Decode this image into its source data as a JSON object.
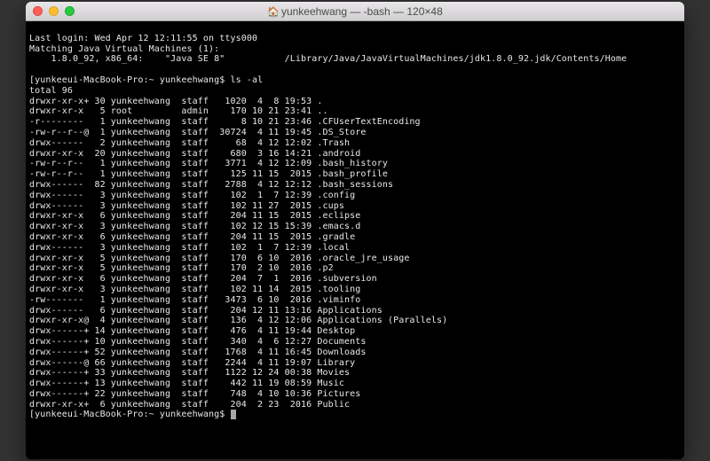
{
  "window": {
    "title_user": "yunkeehwang",
    "title_shell": "-bash",
    "title_size": "120×48"
  },
  "last_login": "Last login: Wed Apr 12 12:11:55 on ttys000",
  "java_match_header": "Matching Java Virtual Machines (1):",
  "java_entry": "    1.8.0_92, x86_64:    \"Java SE 8\"           /Library/Java/JavaVirtualMachines/jdk1.8.0_92.jdk/Contents/Home",
  "prompt_prefix": "[yunkeeui-MacBook-Pro:~ yunkeehwang$",
  "command1": "ls -al",
  "total_line": "total 96",
  "listing": [
    {
      "perm": "drwxr-xr-x+",
      "links": "30",
      "owner": "yunkeehwang",
      "group": "staff",
      "size": "1020",
      "date": " 4  8 19:53",
      "name": "."
    },
    {
      "perm": "drwxr-xr-x ",
      "links": " 5",
      "owner": "root       ",
      "group": "admin",
      "size": " 170",
      "date": "10 21 23:41",
      "name": ".."
    },
    {
      "perm": "-r-------- ",
      "links": " 1",
      "owner": "yunkeehwang",
      "group": "staff",
      "size": "   8",
      "date": "10 21 23:46",
      "name": ".CFUserTextEncoding"
    },
    {
      "perm": "-rw-r--r--@",
      "links": " 1",
      "owner": "yunkeehwang",
      "group": "staff",
      "size": "30724",
      "date": " 4 11 19:45",
      "name": ".DS_Store"
    },
    {
      "perm": "drwx------ ",
      "links": " 2",
      "owner": "yunkeehwang",
      "group": "staff",
      "size": "  68",
      "date": " 4 12 12:02",
      "name": ".Trash"
    },
    {
      "perm": "drwxr-xr-x ",
      "links": "20",
      "owner": "yunkeehwang",
      "group": "staff",
      "size": " 680",
      "date": " 3 16 14:21",
      "name": ".android"
    },
    {
      "perm": "-rw-r--r-- ",
      "links": " 1",
      "owner": "yunkeehwang",
      "group": "staff",
      "size": "3771",
      "date": " 4 12 12:09",
      "name": ".bash_history"
    },
    {
      "perm": "-rw-r--r-- ",
      "links": " 1",
      "owner": "yunkeehwang",
      "group": "staff",
      "size": " 125",
      "date": "11 15  2015",
      "name": ".bash_profile"
    },
    {
      "perm": "drwx------ ",
      "links": "82",
      "owner": "yunkeehwang",
      "group": "staff",
      "size": "2788",
      "date": " 4 12 12:12",
      "name": ".bash_sessions"
    },
    {
      "perm": "drwx------ ",
      "links": " 3",
      "owner": "yunkeehwang",
      "group": "staff",
      "size": " 102",
      "date": " 1  7 12:39",
      "name": ".config"
    },
    {
      "perm": "drwx------ ",
      "links": " 3",
      "owner": "yunkeehwang",
      "group": "staff",
      "size": " 102",
      "date": "11 27  2015",
      "name": ".cups"
    },
    {
      "perm": "drwxr-xr-x ",
      "links": " 6",
      "owner": "yunkeehwang",
      "group": "staff",
      "size": " 204",
      "date": "11 15  2015",
      "name": ".eclipse"
    },
    {
      "perm": "drwxr-xr-x ",
      "links": " 3",
      "owner": "yunkeehwang",
      "group": "staff",
      "size": " 102",
      "date": "12 15 15:39",
      "name": ".emacs.d"
    },
    {
      "perm": "drwxr-xr-x ",
      "links": " 6",
      "owner": "yunkeehwang",
      "group": "staff",
      "size": " 204",
      "date": "11 15  2015",
      "name": ".gradle"
    },
    {
      "perm": "drwx------ ",
      "links": " 3",
      "owner": "yunkeehwang",
      "group": "staff",
      "size": " 102",
      "date": " 1  7 12:39",
      "name": ".local"
    },
    {
      "perm": "drwxr-xr-x ",
      "links": " 5",
      "owner": "yunkeehwang",
      "group": "staff",
      "size": " 170",
      "date": " 6 10  2016",
      "name": ".oracle_jre_usage"
    },
    {
      "perm": "drwxr-xr-x ",
      "links": " 5",
      "owner": "yunkeehwang",
      "group": "staff",
      "size": " 170",
      "date": " 2 10  2016",
      "name": ".p2"
    },
    {
      "perm": "drwxr-xr-x ",
      "links": " 6",
      "owner": "yunkeehwang",
      "group": "staff",
      "size": " 204",
      "date": " 7  1  2016",
      "name": ".subversion"
    },
    {
      "perm": "drwxr-xr-x ",
      "links": " 3",
      "owner": "yunkeehwang",
      "group": "staff",
      "size": " 102",
      "date": "11 14  2015",
      "name": ".tooling"
    },
    {
      "perm": "-rw------- ",
      "links": " 1",
      "owner": "yunkeehwang",
      "group": "staff",
      "size": "3473",
      "date": " 6 10  2016",
      "name": ".viminfo"
    },
    {
      "perm": "drwx------ ",
      "links": " 6",
      "owner": "yunkeehwang",
      "group": "staff",
      "size": " 204",
      "date": "12 11 13:16",
      "name": "Applications"
    },
    {
      "perm": "drwxr-xr-x@",
      "links": " 4",
      "owner": "yunkeehwang",
      "group": "staff",
      "size": " 136",
      "date": " 4 12 12:06",
      "name": "Applications (Parallels)"
    },
    {
      "perm": "drwx------+",
      "links": "14",
      "owner": "yunkeehwang",
      "group": "staff",
      "size": " 476",
      "date": " 4 11 19:44",
      "name": "Desktop"
    },
    {
      "perm": "drwx------+",
      "links": "10",
      "owner": "yunkeehwang",
      "group": "staff",
      "size": " 340",
      "date": " 4  6 12:27",
      "name": "Documents"
    },
    {
      "perm": "drwx------+",
      "links": "52",
      "owner": "yunkeehwang",
      "group": "staff",
      "size": "1768",
      "date": " 4 11 16:45",
      "name": "Downloads"
    },
    {
      "perm": "drwx------@",
      "links": "66",
      "owner": "yunkeehwang",
      "group": "staff",
      "size": "2244",
      "date": " 4 11 19:07",
      "name": "Library"
    },
    {
      "perm": "drwx------+",
      "links": "33",
      "owner": "yunkeehwang",
      "group": "staff",
      "size": "1122",
      "date": "12 24 00:38",
      "name": "Movies"
    },
    {
      "perm": "drwx------+",
      "links": "13",
      "owner": "yunkeehwang",
      "group": "staff",
      "size": " 442",
      "date": "11 19 08:59",
      "name": "Music"
    },
    {
      "perm": "drwx------+",
      "links": "22",
      "owner": "yunkeehwang",
      "group": "staff",
      "size": " 748",
      "date": " 4 10 10:36",
      "name": "Pictures"
    },
    {
      "perm": "drwxr-xr-x+",
      "links": " 6",
      "owner": "yunkeehwang",
      "group": "staff",
      "size": " 204",
      "date": " 2 23  2016",
      "name": "Public"
    }
  ]
}
